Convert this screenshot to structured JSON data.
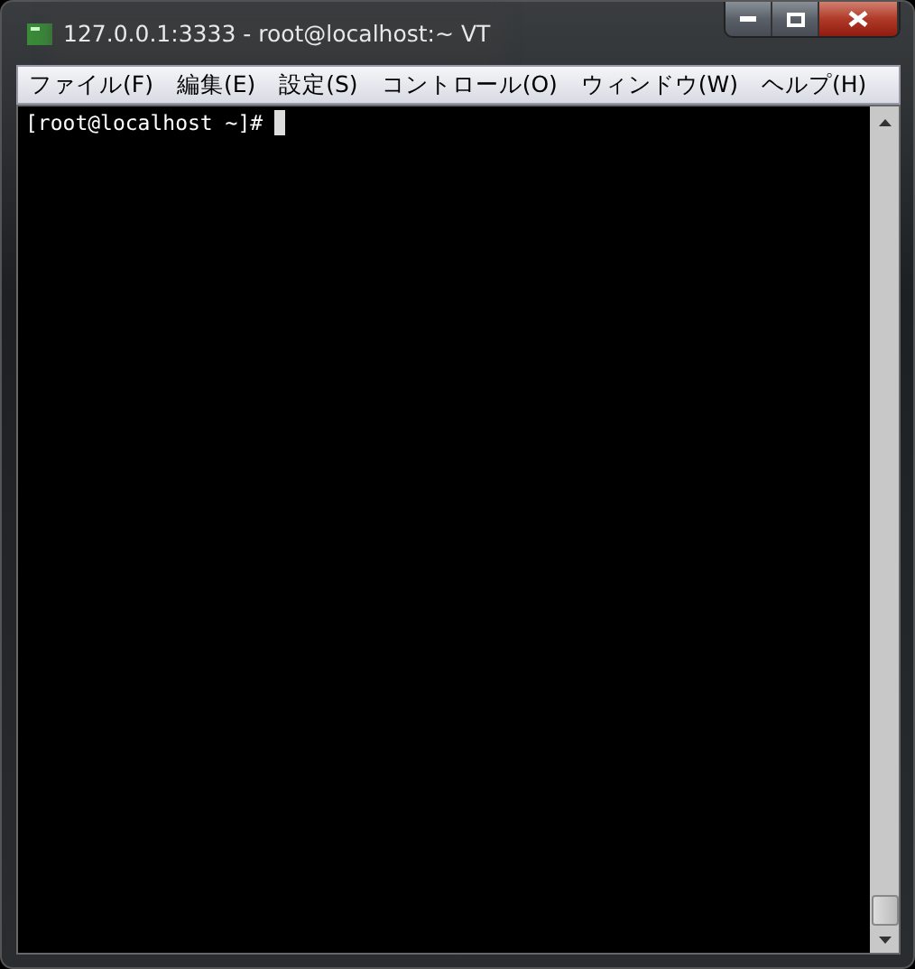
{
  "window": {
    "title": "127.0.0.1:3333 - root@localhost:~ VT"
  },
  "menu": [
    "ファイル(F)",
    "編集(E)",
    "設定(S)",
    "コントロール(O)",
    "ウィンドウ(W)",
    "ヘルプ(H)"
  ],
  "terminal": {
    "prompt": "[root@localhost ~]#"
  }
}
